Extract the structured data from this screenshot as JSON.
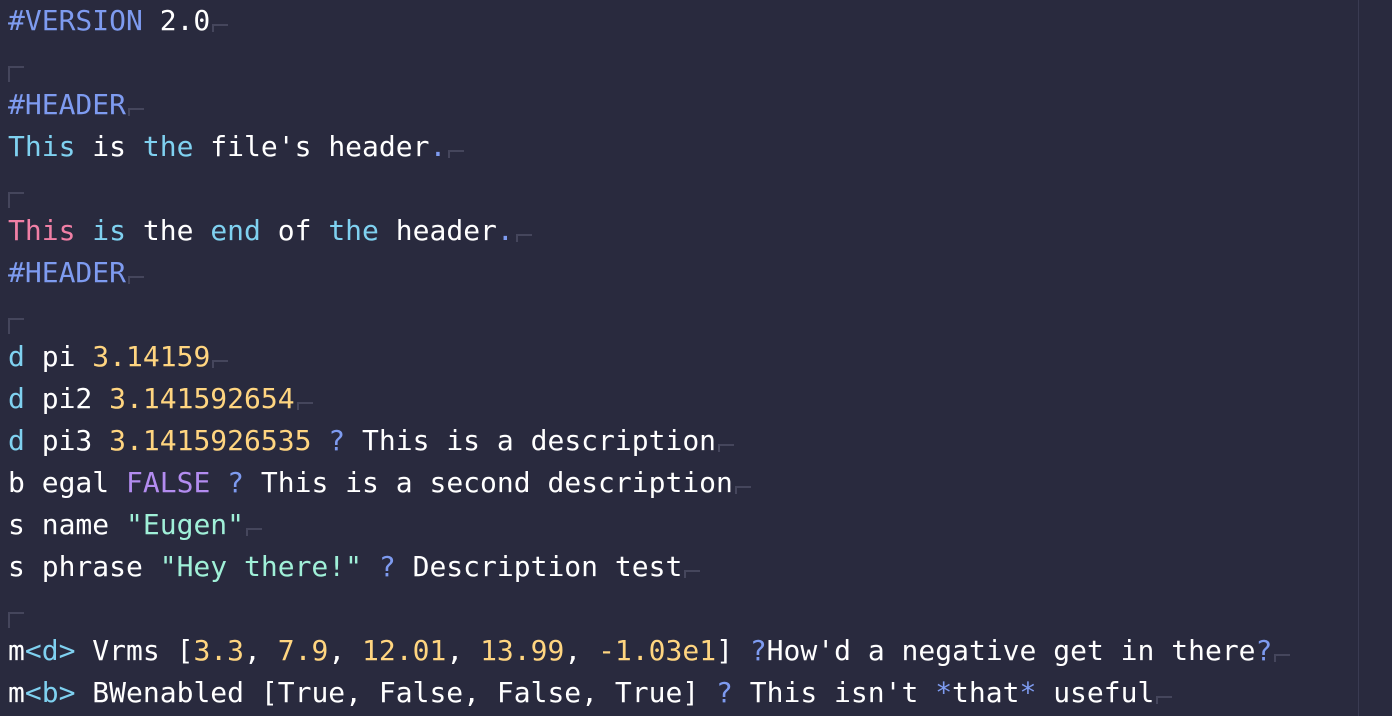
{
  "lines": [
    {
      "tokens": [
        {
          "t": "#VERSION",
          "c": "c-directive"
        },
        {
          "t": " 2.0",
          "c": "c-text"
        }
      ]
    },
    {
      "tokens": []
    },
    {
      "tokens": [
        {
          "t": "#HEADER",
          "c": "c-directive"
        }
      ]
    },
    {
      "tokens": [
        {
          "t": "This",
          "c": "c-kw"
        },
        {
          "t": " is ",
          "c": "c-text"
        },
        {
          "t": "the",
          "c": "c-kw"
        },
        {
          "t": " file's header",
          "c": "c-text"
        },
        {
          "t": ".",
          "c": "c-punct"
        }
      ]
    },
    {
      "tokens": []
    },
    {
      "tokens": [
        {
          "t": "This",
          "c": "c-pink"
        },
        {
          "t": " ",
          "c": "c-text"
        },
        {
          "t": "is",
          "c": "c-kw"
        },
        {
          "t": " the ",
          "c": "c-text"
        },
        {
          "t": "end",
          "c": "c-kw"
        },
        {
          "t": " of ",
          "c": "c-text"
        },
        {
          "t": "the",
          "c": "c-kw"
        },
        {
          "t": " header",
          "c": "c-text"
        },
        {
          "t": ".",
          "c": "c-punct"
        }
      ]
    },
    {
      "tokens": [
        {
          "t": "#HEADER",
          "c": "c-directive"
        }
      ]
    },
    {
      "tokens": []
    },
    {
      "tokens": [
        {
          "t": "d",
          "c": "c-kw"
        },
        {
          "t": " pi ",
          "c": "c-text"
        },
        {
          "t": "3.14159",
          "c": "c-num"
        }
      ]
    },
    {
      "tokens": [
        {
          "t": "d",
          "c": "c-kw"
        },
        {
          "t": " pi2 ",
          "c": "c-text"
        },
        {
          "t": "3.141592654",
          "c": "c-num"
        }
      ]
    },
    {
      "tokens": [
        {
          "t": "d",
          "c": "c-kw"
        },
        {
          "t": " pi3 ",
          "c": "c-text"
        },
        {
          "t": "3.1415926535",
          "c": "c-num"
        },
        {
          "t": " ?",
          "c": "c-q"
        },
        {
          "t": " This is a description",
          "c": "c-text"
        }
      ]
    },
    {
      "tokens": [
        {
          "t": "b egal ",
          "c": "c-text"
        },
        {
          "t": "FALSE",
          "c": "c-bool"
        },
        {
          "t": " ?",
          "c": "c-q"
        },
        {
          "t": " This is a second description",
          "c": "c-text"
        }
      ]
    },
    {
      "tokens": [
        {
          "t": "s name ",
          "c": "c-text"
        },
        {
          "t": "\"Eugen\"",
          "c": "c-str"
        }
      ]
    },
    {
      "tokens": [
        {
          "t": "s phrase ",
          "c": "c-text"
        },
        {
          "t": "\"Hey there!\"",
          "c": "c-str"
        },
        {
          "t": " ?",
          "c": "c-q"
        },
        {
          "t": " Description test",
          "c": "c-text"
        }
      ]
    },
    {
      "tokens": []
    },
    {
      "tokens": [
        {
          "t": "m",
          "c": "c-text"
        },
        {
          "t": "<d>",
          "c": "c-kw"
        },
        {
          "t": " Vrms [",
          "c": "c-text"
        },
        {
          "t": "3.3",
          "c": "c-num"
        },
        {
          "t": ", ",
          "c": "c-text"
        },
        {
          "t": "7.9",
          "c": "c-num"
        },
        {
          "t": ", ",
          "c": "c-text"
        },
        {
          "t": "12.01",
          "c": "c-num"
        },
        {
          "t": ", ",
          "c": "c-text"
        },
        {
          "t": "13.99",
          "c": "c-num"
        },
        {
          "t": ", ",
          "c": "c-text"
        },
        {
          "t": "-1.03e1",
          "c": "c-num"
        },
        {
          "t": "] ",
          "c": "c-text"
        },
        {
          "t": "?",
          "c": "c-q"
        },
        {
          "t": "How'd a negative get in there",
          "c": "c-text"
        },
        {
          "t": "?",
          "c": "c-q"
        }
      ]
    },
    {
      "tokens": [
        {
          "t": "m",
          "c": "c-text"
        },
        {
          "t": "<b>",
          "c": "c-kw"
        },
        {
          "t": " BWenabled [True, False, False, True] ",
          "c": "c-text"
        },
        {
          "t": "?",
          "c": "c-q"
        },
        {
          "t": " This isn't ",
          "c": "c-text"
        },
        {
          "t": "*",
          "c": "c-q"
        },
        {
          "t": "that",
          "c": "c-text"
        },
        {
          "t": "*",
          "c": "c-q"
        },
        {
          "t": " useful",
          "c": "c-text"
        }
      ]
    }
  ]
}
